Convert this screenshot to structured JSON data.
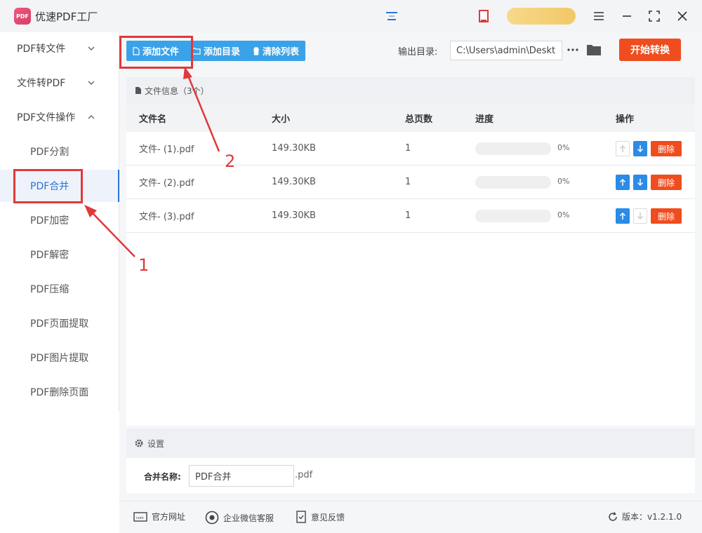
{
  "app": {
    "title": "优速PDF工厂",
    "logo_text": "PDF"
  },
  "sidebar": {
    "groups": [
      {
        "label": "PDF转文件"
      },
      {
        "label": "文件转PDF"
      },
      {
        "label": "PDF文件操作"
      }
    ],
    "items": [
      {
        "label": "PDF分割"
      },
      {
        "label": "PDF合并"
      },
      {
        "label": "PDF加密"
      },
      {
        "label": "PDF解密"
      },
      {
        "label": "PDF压缩"
      },
      {
        "label": "PDF页面提取"
      },
      {
        "label": "PDF图片提取"
      },
      {
        "label": "PDF删除页面"
      }
    ]
  },
  "toolbar": {
    "add_file": "添加文件",
    "add_folder": "添加目录",
    "clear_list": "清除列表",
    "output_label": "输出目录:",
    "output_path": "C:\\Users\\admin\\Desktop",
    "start": "开始转换"
  },
  "file_panel": {
    "header": "文件信息（3个）",
    "columns": {
      "name": "文件名",
      "size": "大小",
      "pages": "总页数",
      "progress": "进度",
      "actions": "操作"
    },
    "rows": [
      {
        "name": "文件- (1).pdf",
        "size": "149.30KB",
        "pages": "1",
        "progress": "0%",
        "progress_value": 0,
        "delete": "删除"
      },
      {
        "name": "文件- (2).pdf",
        "size": "149.30KB",
        "pages": "1",
        "progress": "0%",
        "progress_value": 0,
        "delete": "删除"
      },
      {
        "name": "文件- (3).pdf",
        "size": "149.30KB",
        "pages": "1",
        "progress": "0%",
        "progress_value": 0,
        "delete": "删除"
      }
    ]
  },
  "settings": {
    "header": "设置",
    "merge_label": "合并名称:",
    "merge_value": "PDF合并",
    "merge_ext": ".pdf"
  },
  "footer": {
    "website": "官方网址",
    "support": "企业微信客服",
    "feedback": "意见反馈",
    "version": "版本：v1.2.1.0"
  },
  "annotations": {
    "one": "1",
    "two": "2"
  },
  "colors": {
    "accent": "#3aa2e8",
    "danger": "#ef4d1e",
    "active": "#2b74d6",
    "annotation": "#e0393a"
  }
}
